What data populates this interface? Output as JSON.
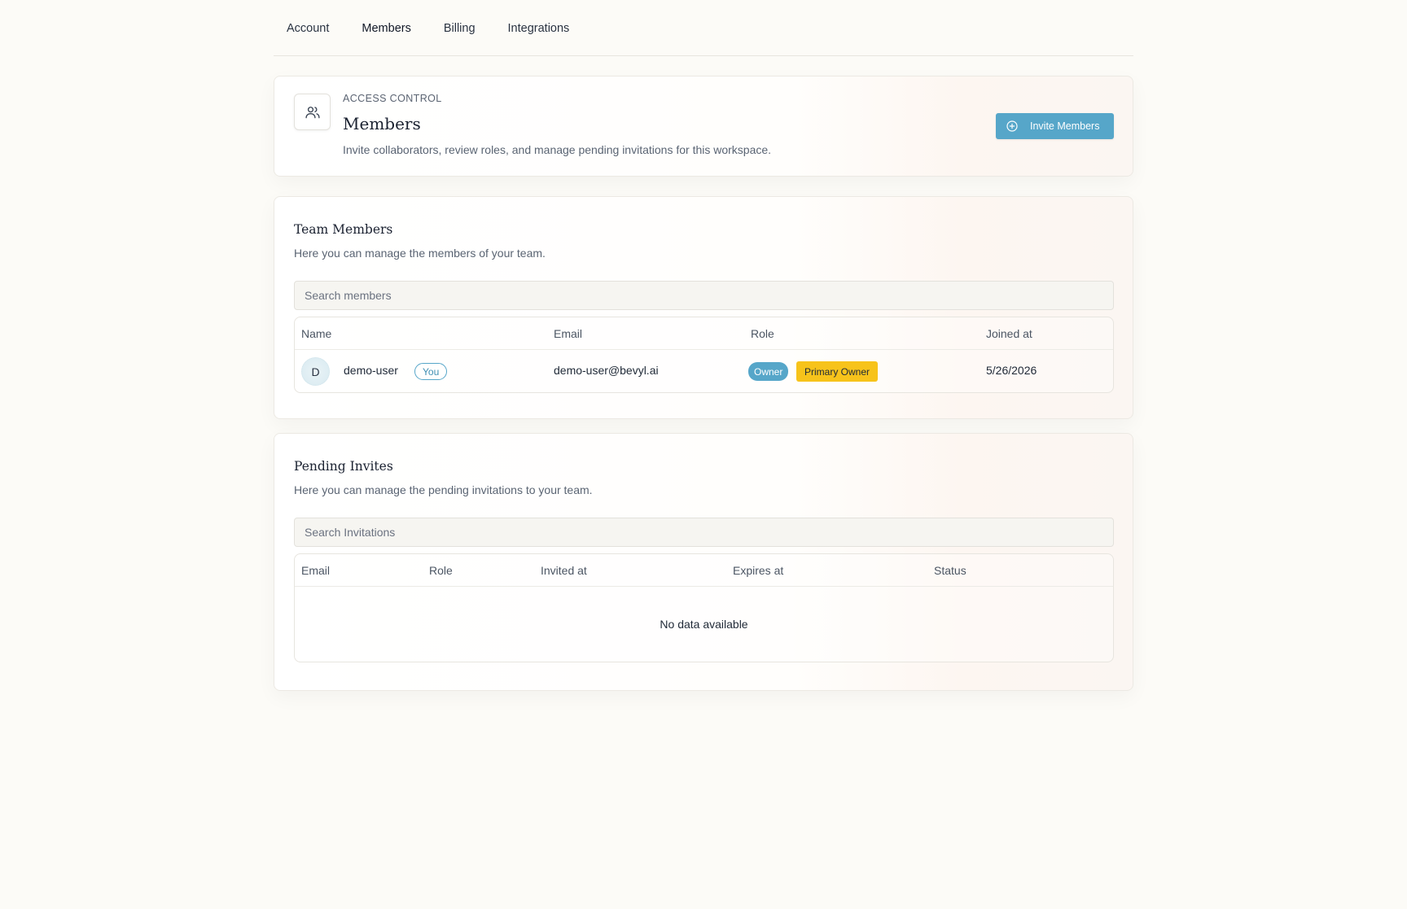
{
  "tabs": [
    {
      "label": "Account"
    },
    {
      "label": "Members"
    },
    {
      "label": "Billing"
    },
    {
      "label": "Integrations"
    }
  ],
  "active_tab": "Members",
  "header": {
    "eyebrow": "ACCESS CONTROL",
    "title": "Members",
    "subtitle": "Invite collaborators, review roles, and manage pending invitations for this workspace.",
    "icon": "users-icon",
    "invite_button_label": "Invite Members",
    "invite_button_icon": "plus-circle-icon"
  },
  "team": {
    "title": "Team Members",
    "subtitle": "Here you can manage the members of your team.",
    "search_placeholder": "Search members",
    "columns": [
      "Name",
      "Email",
      "Role",
      "Joined at"
    ],
    "rows": [
      {
        "avatar_initial": "D",
        "name": "demo-user",
        "you_badge": "You",
        "email": "demo-user@bevyl.ai",
        "role_badges": [
          "Owner",
          "Primary Owner"
        ],
        "joined_at": "5/26/2026"
      }
    ]
  },
  "pending": {
    "title": "Pending Invites",
    "subtitle": "Here you can manage the pending invitations to your team.",
    "search_placeholder": "Search Invitations",
    "columns": [
      "Email",
      "Role",
      "Invited at",
      "Expires at",
      "Status"
    ],
    "empty_message": "No data available"
  },
  "colors": {
    "accent": "#56a6c9",
    "primary_owner_badge": "#f7c31b",
    "page_background": "#fcfbf7"
  }
}
